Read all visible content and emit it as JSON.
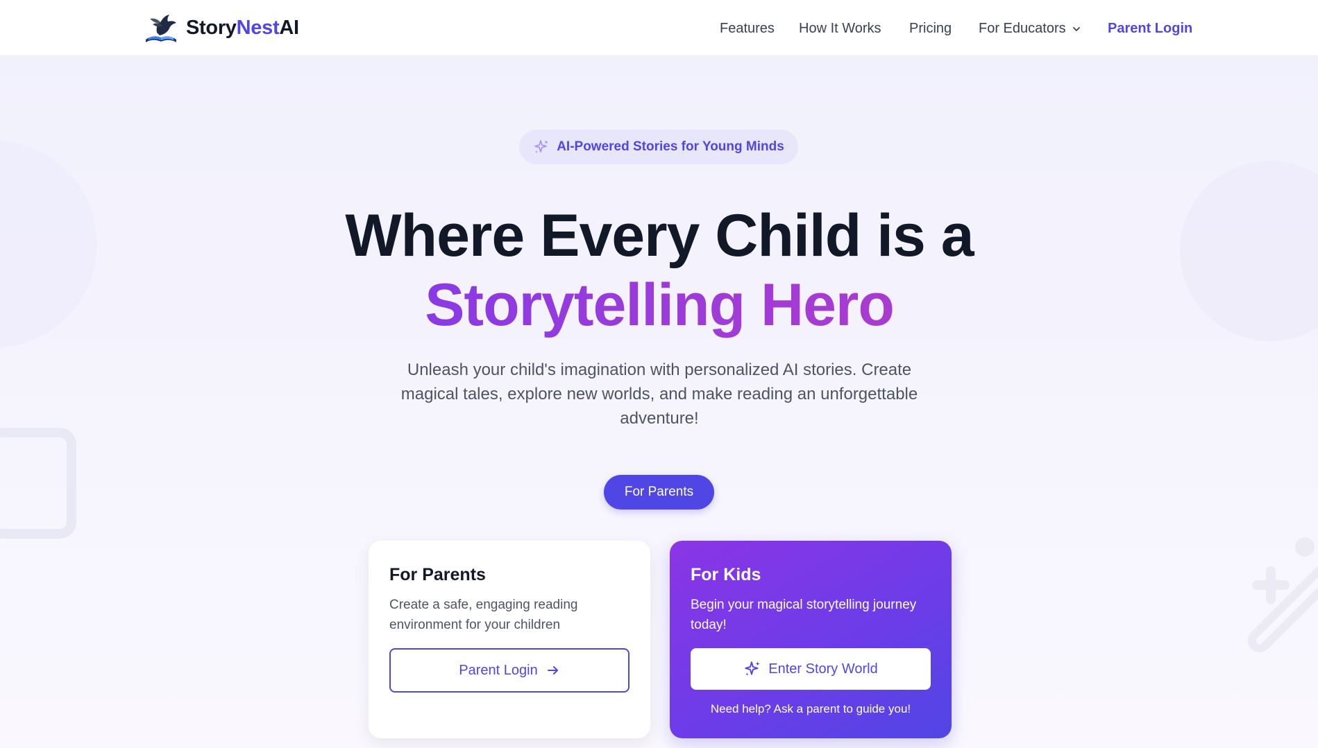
{
  "brand": {
    "name_part1": "Story",
    "name_part2": "Nest",
    "name_part3": "AI",
    "logo_icon": "bird-on-book-icon"
  },
  "nav": {
    "items": [
      {
        "label": "Features"
      },
      {
        "label": "How It Works"
      },
      {
        "label": "Pricing"
      },
      {
        "label": "For Educators",
        "icon": "chevron-down-icon"
      }
    ],
    "login_label": "Parent Login"
  },
  "hero": {
    "badge": {
      "icon": "sparkles-icon",
      "text": "AI-Powered Stories for Young Minds"
    },
    "headline_line1": "Where Every Child is a",
    "headline_line2": "Storytelling Hero",
    "subtitle": "Unleash your child's imagination with personalized AI stories. Create magical tales, explore new worlds, and make reading an unforgettable adventure!",
    "pill_button": "For Parents"
  },
  "cards": {
    "parents": {
      "title": "For Parents",
      "description": "Create a safe, engaging reading environment for your children",
      "button_label": "Parent Login",
      "button_icon": "arrow-right-icon"
    },
    "kids": {
      "title": "For Kids",
      "description": "Begin your magical storytelling journey today!",
      "button_label": "Enter Story World",
      "button_icon": "sparkles-icon",
      "help_text": "Need help? Ask a parent to guide you!"
    }
  },
  "colors": {
    "primary": "#4f46e5",
    "gradient_start": "#8b35e6",
    "gradient_end": "#5146e5",
    "text_dark": "#111827",
    "text_muted": "#4b5563"
  }
}
